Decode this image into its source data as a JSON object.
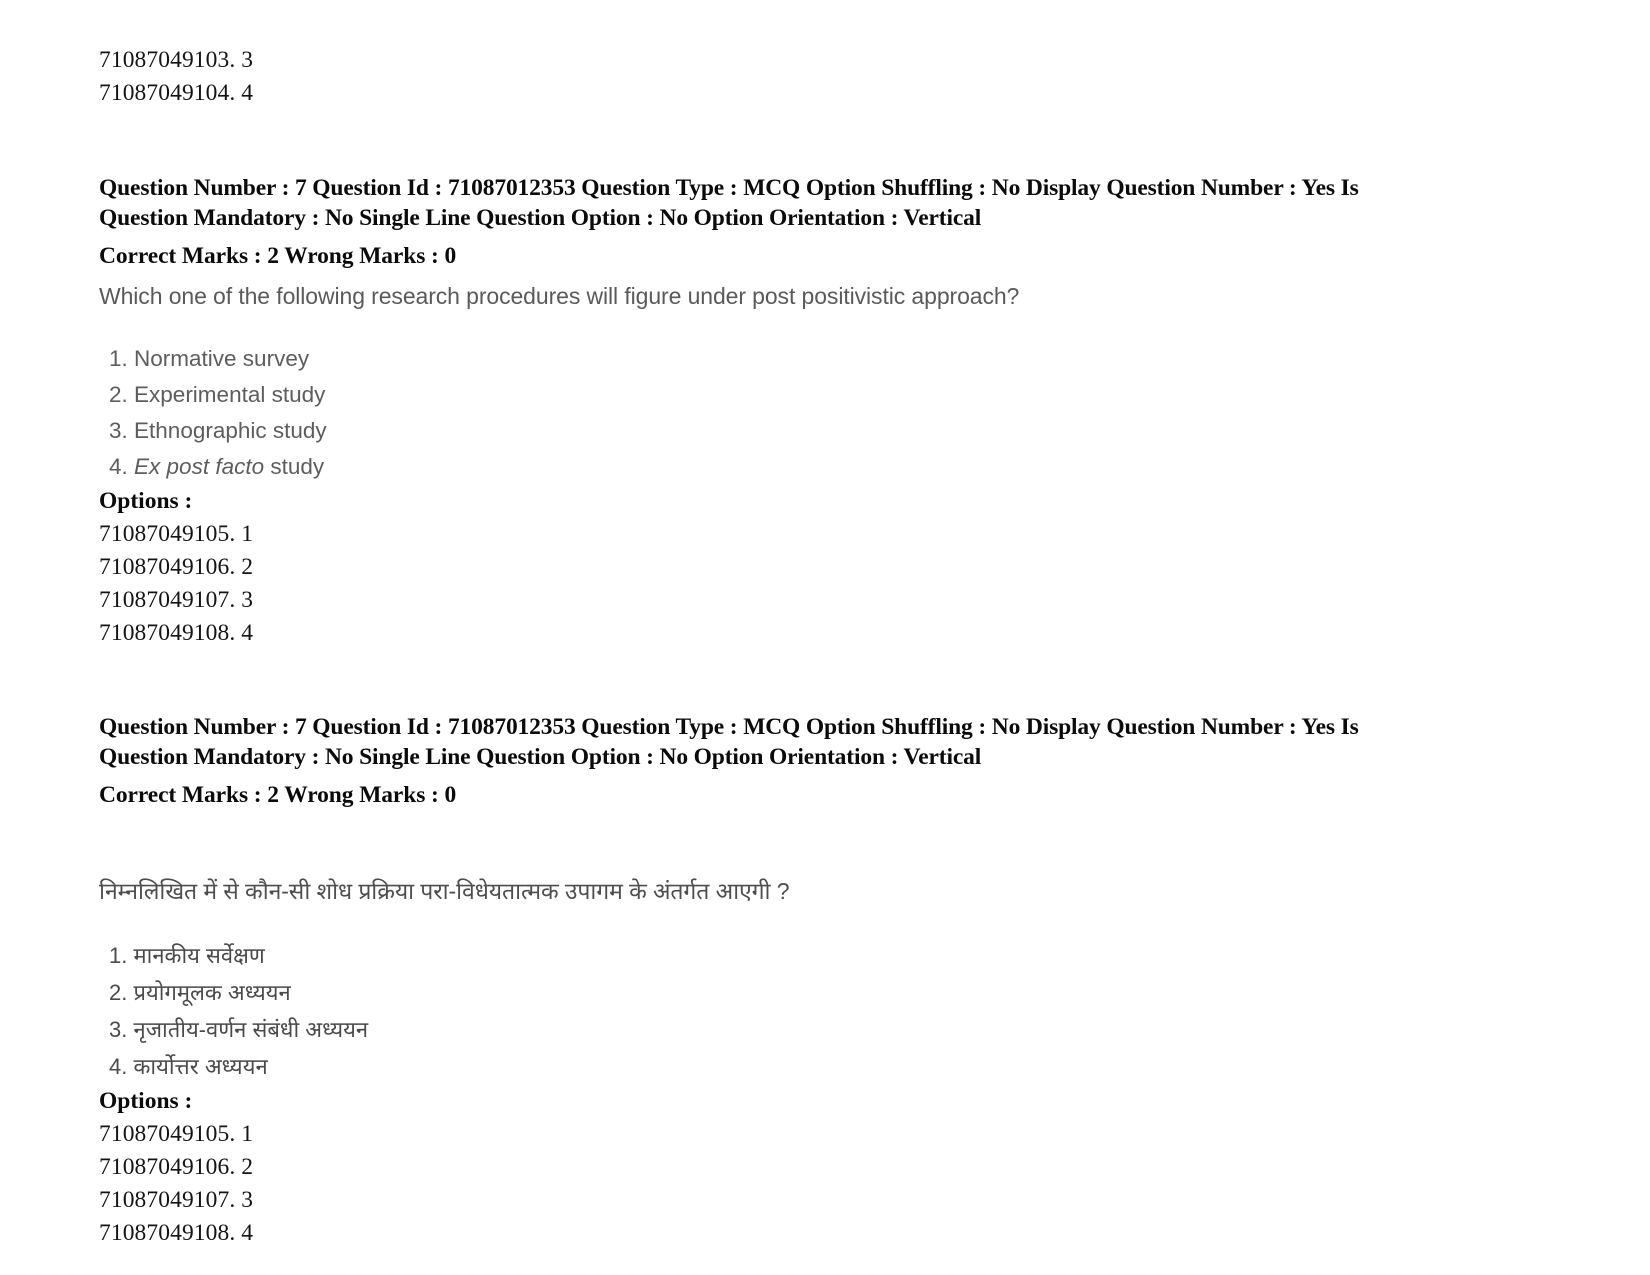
{
  "document": {
    "top_option_ids": [
      "71087049103. 3",
      "71087049104. 4"
    ],
    "blocks": [
      {
        "meta_line_1": "Question Number : 7 Question Id : 71087012353 Question Type : MCQ Option Shuffling : No Display Question Number : Yes Is",
        "meta_line_2": "Question Mandatory : No Single Line Question Option : No Option Orientation : Vertical",
        "marks_line": "Correct Marks : 2 Wrong Marks : 0",
        "question_text": "Which one of the following research procedures will figure under post positivistic approach?",
        "choices": [
          {
            "number": "1.",
            "text": "Normative survey",
            "italic_part": "",
            "plain_part": "Normative survey"
          },
          {
            "number": "2.",
            "text": "Experimental study",
            "italic_part": "",
            "plain_part": "Experimental study"
          },
          {
            "number": "3.",
            "text": "Ethnographic study",
            "italic_part": "",
            "plain_part": "Ethnographic study"
          },
          {
            "number": "4.",
            "text": "Ex post facto study",
            "italic_part": "Ex post facto",
            "plain_part": " study"
          }
        ],
        "options_label": "Options :",
        "option_ids": [
          "71087049105. 1",
          "71087049106. 2",
          "71087049107. 3",
          "71087049108. 4"
        ]
      },
      {
        "meta_line_1": "Question Number : 7 Question Id : 71087012353 Question Type : MCQ Option Shuffling : No Display Question Number : Yes Is",
        "meta_line_2": "Question Mandatory : No Single Line Question Option : No Option Orientation : Vertical",
        "marks_line": "Correct Marks : 2 Wrong Marks : 0",
        "question_text": "निम्नलिखित में से कौन-सी शोध प्रक्रिया परा-विधेयतात्मक उपागम के अंतर्गत आएगी ?",
        "choices": [
          {
            "number": "1.",
            "text": "मानकीय सर्वेक्षण",
            "italic_part": "",
            "plain_part": "मानकीय सर्वेक्षण"
          },
          {
            "number": "2.",
            "text": "प्रयोगमूलक अध्ययन",
            "italic_part": "",
            "plain_part": "प्रयोगमूलक अध्ययन"
          },
          {
            "number": "3.",
            "text": "नृजातीय-वर्णन संबंधी अध्ययन",
            "italic_part": "",
            "plain_part": "नृजातीय-वर्णन संबंधी अध्ययन"
          },
          {
            "number": "4.",
            "text": "कार्योत्तर अध्ययन",
            "italic_part": "",
            "plain_part": "कार्योत्तर अध्ययन"
          }
        ],
        "options_label": "Options :",
        "option_ids": [
          "71087049105. 1",
          "71087049106. 2",
          "71087049107. 3",
          "71087049108. 4"
        ]
      }
    ]
  }
}
